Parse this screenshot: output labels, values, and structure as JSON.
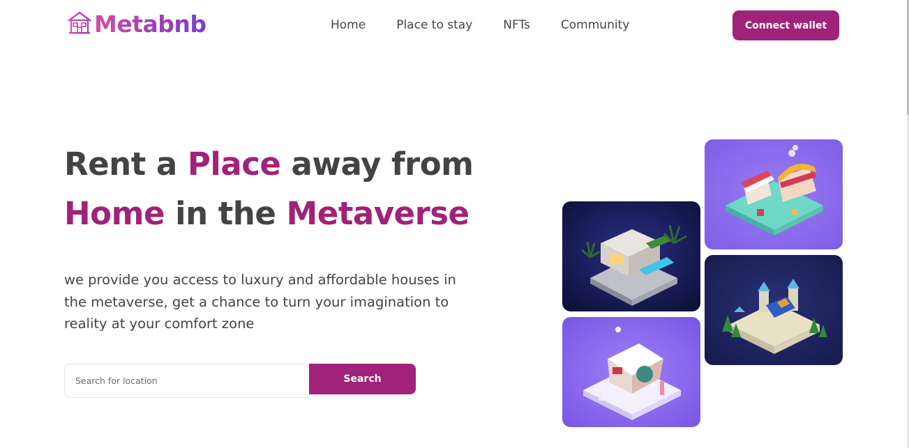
{
  "brand": {
    "name": "Metabnb",
    "logo_icon": "house-icon",
    "gradient_colors": [
      "#d24fa0",
      "#7b3ad9"
    ]
  },
  "nav": {
    "links": [
      "Home",
      "Place to stay",
      "NFTs",
      "Community"
    ]
  },
  "header": {
    "connect_label": "Connect wallet"
  },
  "hero": {
    "title_parts": [
      "Rent a ",
      "Place",
      " away from",
      "Home",
      " in the ",
      "Metaverse"
    ],
    "description": "we provide you access to luxury and affordable houses in the metaverse, get a chance to turn your imagination to reality at your comfort zone"
  },
  "search": {
    "placeholder": "Search for location",
    "button_label": "Search"
  },
  "gallery": [
    {
      "id": "villa",
      "theme": "night villa with pool"
    },
    {
      "id": "market",
      "theme": "market stalls"
    },
    {
      "id": "snow-house",
      "theme": "snowy cottage"
    },
    {
      "id": "castle",
      "theme": "castle with trees"
    }
  ],
  "colors": {
    "accent": "#a02279",
    "text": "#434343",
    "tile_purple": "#8a68ec",
    "tile_navy": "#1c2157"
  }
}
